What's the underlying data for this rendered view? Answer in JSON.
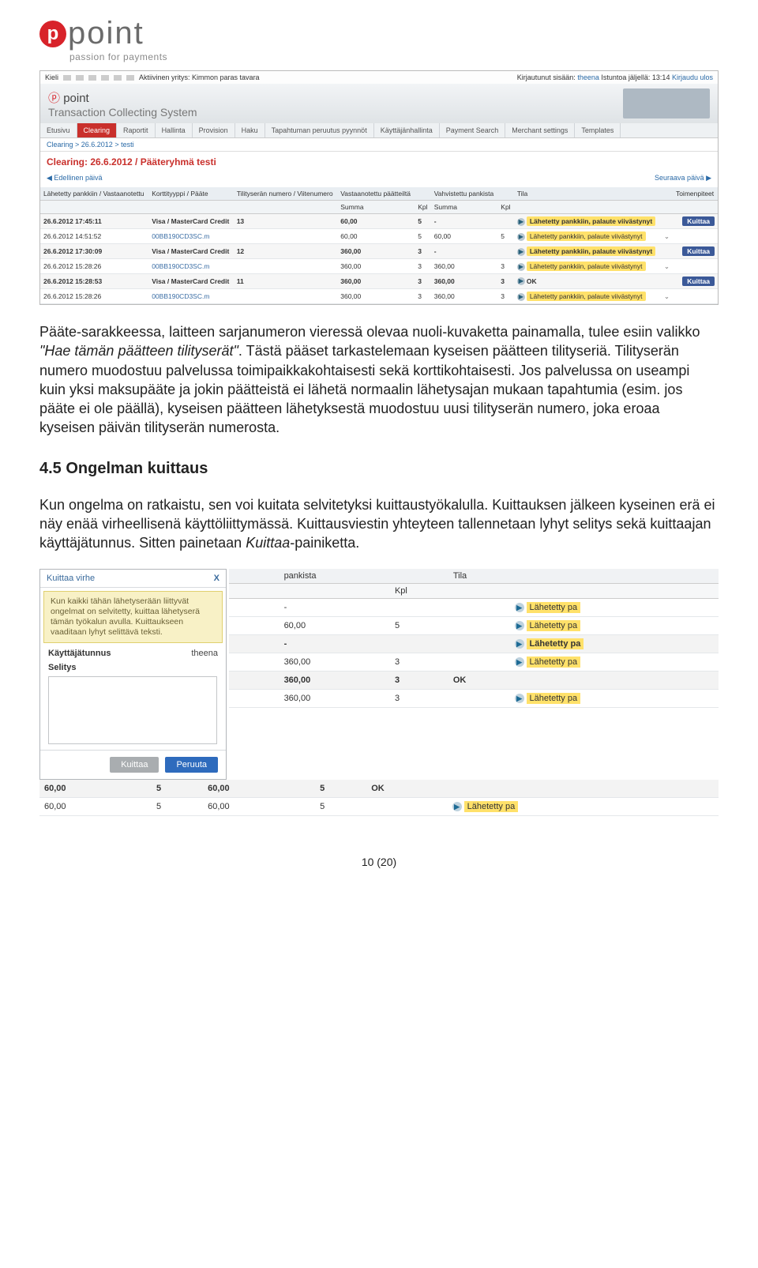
{
  "logo": {
    "mark": "p",
    "main": "point",
    "tagline": "passion for payments"
  },
  "screenshot1": {
    "topbar_left": {
      "kieli": "Kieli",
      "active_co": "Aktiivinen yritys: Kimmon paras tavara"
    },
    "topbar_right": {
      "logged": "Kirjautunut sisään:",
      "user": "theena",
      "timelabel": "Istuntoa jäljellä:",
      "time": "13:14",
      "logout": "Kirjaudu ulos"
    },
    "brand1": "point",
    "brand2": "Transaction Collecting System",
    "tabs": [
      "Etusivu",
      "Clearing",
      "Raportit",
      "Hallinta",
      "Provision",
      "Haku",
      "Tapahtuman peruutus pyynnöt",
      "Käyttäjänhallinta",
      "Payment Search",
      "Merchant settings",
      "Templates"
    ],
    "breadcrumb": "Clearing > 26.6.2012 > testi",
    "title": "Clearing: 26.6.2012 / Pääteryhmä testi",
    "prev": "Edellinen päivä",
    "next": "Seuraava päivä",
    "headers": [
      "Lähetetty pankkiin / Vastaanotettu",
      "Korttityyppi / Pääte",
      "Tilityserän numero / Viitenumero",
      "Vastaanotettu päätteiltä",
      "",
      "Vahvistettu pankista",
      "",
      "Tila",
      "",
      "Toimenpiteet"
    ],
    "subheaders": [
      "",
      "",
      "",
      "Summa",
      "Kpl",
      "Summa",
      "Kpl",
      "",
      "",
      ""
    ],
    "groups": [
      {
        "grow": [
          "26.6.2012 17:45:11",
          "Visa / MasterCard Credit",
          "13",
          "60,00",
          "5",
          "-",
          "",
          "Lähetetty pankkiin, palaute viivästynyt",
          "",
          "Kuittaa"
        ],
        "sub": [
          "26.6.2012 14:51:52",
          "00BB190CD3SC.m",
          "",
          "60,00",
          "5",
          "60,00",
          "5",
          "Lähetetty pankkiin, palaute viivästynyt",
          "",
          ""
        ]
      },
      {
        "grow": [
          "26.6.2012 17:30:09",
          "Visa / MasterCard Credit",
          "12",
          "360,00",
          "3",
          "-",
          "",
          "Lähetetty pankkiin, palaute viivästynyt",
          "",
          "Kuittaa"
        ],
        "sub": [
          "26.6.2012 15:28:26",
          "00BB190CD3SC.m",
          "",
          "360,00",
          "3",
          "360,00",
          "3",
          "Lähetetty pankkiin, palaute viivästynyt",
          "",
          ""
        ]
      },
      {
        "grow": [
          "26.6.2012 15:28:53",
          "Visa / MasterCard Credit",
          "11",
          "360,00",
          "3",
          "360,00",
          "3",
          "OK",
          "",
          "Kuittaa"
        ],
        "sub": [
          "26.6.2012 15:28:26",
          "00BB190CD3SC.m",
          "",
          "360,00",
          "3",
          "360,00",
          "3",
          "Lähetetty pankkiin, palaute viivästynyt",
          "",
          ""
        ]
      }
    ]
  },
  "paragraph1_before_it1": "Pääte-sarakkeessa, laitteen sarjanumeron vieressä olevaa nuoli-kuvaketta painamalla, tulee esiin valikko ",
  "paragraph1_it1": "\"Hae tämän päätteen tilityserät\"",
  "paragraph1_rest": ". Tästä pääset tarkastelemaan kyseisen päätteen tilityseriä. Tilityserän numero muodostuu palvelussa toimipaikkakohtaisesti sekä korttikohtaisesti. Jos palvelussa on useampi kuin yksi maksupääte ja jokin päätteistä ei lähetä normaalin lähetysajan mukaan tapahtumia (esim. jos pääte ei ole päällä), kyseisen päätteen lähetyksestä muodostuu uusi tilityserän numero, joka eroaa kyseisen päivän tilityserän numerosta.",
  "section45": "4.5  Ongelman kuittaus",
  "paragraph2_a": "Kun ongelma on ratkaistu, sen voi kuitata selvitetyksi kuittaustyökalulla. Kuittauksen jälkeen kyseinen erä ei näy enää virheellisenä käyttöliittymässä. Kuittausviestin yhteyteen tallennetaan lyhyt selitys sekä kuittaajan käyttäjätunnus. Sitten painetaan ",
  "paragraph2_it": "Kuittaa",
  "paragraph2_b": "-painiketta.",
  "modal": {
    "title": "Kuittaa virhe",
    "close": "X",
    "help": "Kun kaikki tähän lähetyserään liittyvät ongelmat on selvitetty, kuittaa lähetyserä tämän työkalun avulla. Kuittaukseen vaaditaan lyhyt selittävä teksti.",
    "userlabel": "Käyttäjätunnus",
    "userval": "theena",
    "desclabel": "Selitys",
    "btn_ok": "Kuittaa",
    "btn_cancel": "Peruuta"
  },
  "bgtable": {
    "headers": [
      "",
      "",
      "pankista",
      "",
      "Tila",
      ""
    ],
    "subheaders": [
      "",
      "",
      "",
      "Kpl",
      "",
      ""
    ],
    "rows": [
      {
        "g": false,
        "c": [
          "",
          "",
          "-",
          "",
          "",
          "Lähetetty pa"
        ]
      },
      {
        "g": false,
        "c": [
          "",
          "",
          "60,00",
          "5",
          "",
          "Lähetetty pa"
        ]
      },
      {
        "g": true,
        "c": [
          "",
          "",
          "-",
          "",
          "",
          "Lähetetty pa"
        ]
      },
      {
        "g": false,
        "c": [
          "",
          "",
          "360,00",
          "3",
          "",
          "Lähetetty pa"
        ]
      },
      {
        "g": true,
        "c": [
          "",
          "",
          "360,00",
          "3",
          "OK",
          ""
        ]
      },
      {
        "g": false,
        "c": [
          "",
          "",
          "360,00",
          "3",
          "",
          "Lähetetty pa"
        ]
      }
    ],
    "full": [
      {
        "g": true,
        "c": [
          "60,00",
          "5",
          "60,00",
          "5",
          "OK",
          ""
        ]
      },
      {
        "g": false,
        "c": [
          "60,00",
          "5",
          "60,00",
          "5",
          "",
          "Lähetetty pa"
        ]
      }
    ]
  },
  "pagenum": "10 (20)"
}
